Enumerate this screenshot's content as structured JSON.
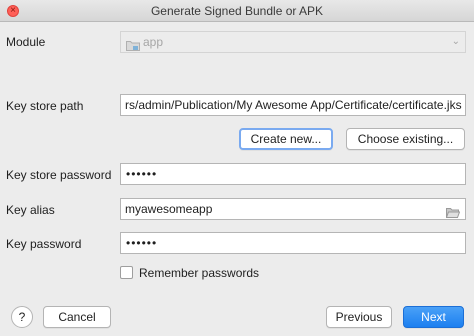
{
  "window": {
    "title": "Generate Signed Bundle or APK",
    "close_glyph": "×"
  },
  "module": {
    "label": "Module",
    "value": "app",
    "icon": "folder-icon"
  },
  "key_store_path": {
    "label": "Key store path",
    "value": "rs/admin/Publication/My Awesome App/Certificate/certificate.jks"
  },
  "buttons": {
    "create_new": "Create new...",
    "choose_existing": "Choose existing...",
    "help": "?",
    "cancel": "Cancel",
    "previous": "Previous",
    "next": "Next"
  },
  "key_store_password": {
    "label": "Key store password",
    "value": "••••••"
  },
  "key_alias": {
    "label": "Key alias",
    "value": "myawesomeapp",
    "icon": "folder-open-icon"
  },
  "key_password": {
    "label": "Key password",
    "value": "••••••"
  },
  "remember": {
    "label": "Remember passwords",
    "checked": false
  },
  "colors": {
    "accent": "#1c7ff0",
    "focus": "#6ea8e8",
    "background": "#ececec"
  }
}
